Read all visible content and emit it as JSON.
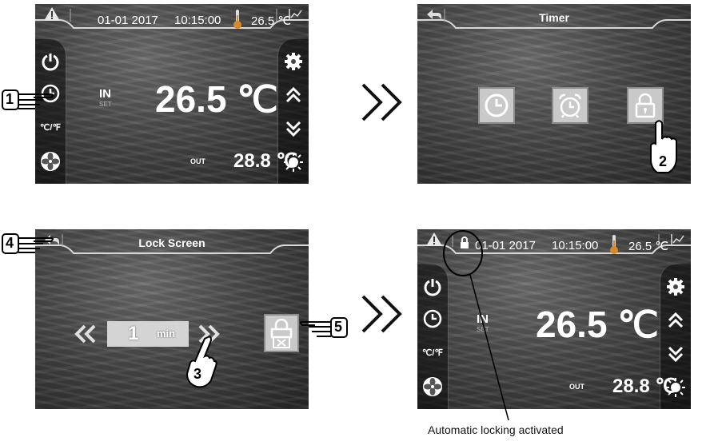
{
  "colors": {
    "accent": "#ffffff",
    "tile": "#c9c9c9",
    "screen_bg": "#3c3c3c"
  },
  "home": {
    "date": "01-01 2017",
    "time": "10:15:00",
    "top_temp": "26.5 ℃",
    "in_label": "IN",
    "set_label": "SET",
    "main_temp": "26.5 ℃",
    "out_label": "OUT",
    "out_temp": "28.8 ℃",
    "unit_toggle": "℃/℉",
    "icons": [
      "warning-icon",
      "thermometer-icon",
      "chart-icon",
      "power-icon",
      "clock-icon",
      "fan-icon",
      "gear-icon",
      "double-up-icon",
      "double-down-icon",
      "sun-icon"
    ]
  },
  "timer": {
    "title": "Timer",
    "icons": [
      "back-icon",
      "clock-icon",
      "alarm-clock-icon",
      "lock-icon"
    ]
  },
  "lock_screen": {
    "title": "Lock Screen",
    "value": "1",
    "unit": "min",
    "icons": [
      "back-icon",
      "double-left-icon",
      "double-right-icon",
      "lock-cancel-icon"
    ]
  },
  "callouts": [
    "1",
    "2",
    "3",
    "4",
    "5"
  ],
  "caption": "Automatic locking activated"
}
